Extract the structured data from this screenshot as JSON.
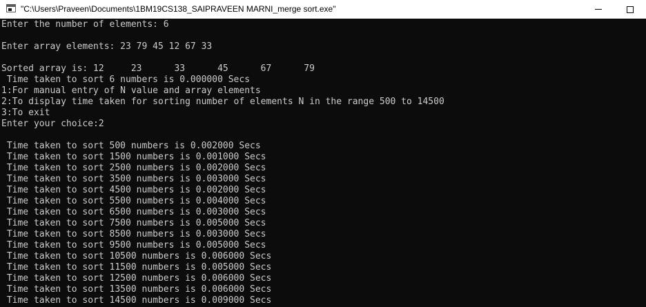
{
  "window": {
    "title": "\"C:\\Users\\Praveen\\Documents\\1BM19CS138_SAIPRAVEEN MARNI_merge sort.exe\"",
    "icon": "console-app-icon"
  },
  "console": {
    "lines": [
      "Enter the number of elements: 6",
      "",
      "Enter array elements: 23 79 45 12 67 33",
      "",
      "Sorted array is: 12     23      33      45      67      79",
      " Time taken to sort 6 numbers is 0.000000 Secs",
      "1:For manual entry of N value and array elements",
      "2:To display time taken for sorting number of elements N in the range 500 to 14500",
      "3:To exit",
      "Enter your choice:2",
      "",
      " Time taken to sort 500 numbers is 0.002000 Secs",
      " Time taken to sort 1500 numbers is 0.001000 Secs",
      " Time taken to sort 2500 numbers is 0.002000 Secs",
      " Time taken to sort 3500 numbers is 0.003000 Secs",
      " Time taken to sort 4500 numbers is 0.002000 Secs",
      " Time taken to sort 5500 numbers is 0.004000 Secs",
      " Time taken to sort 6500 numbers is 0.003000 Secs",
      " Time taken to sort 7500 numbers is 0.005000 Secs",
      " Time taken to sort 8500 numbers is 0.003000 Secs",
      " Time taken to sort 9500 numbers is 0.005000 Secs",
      " Time taken to sort 10500 numbers is 0.006000 Secs",
      " Time taken to sort 11500 numbers is 0.005000 Secs",
      " Time taken to sort 12500 numbers is 0.006000 Secs",
      " Time taken to sort 13500 numbers is 0.006000 Secs",
      " Time taken to sort 14500 numbers is 0.009000 Secs"
    ]
  },
  "colors": {
    "console_bg": "#0c0c0c",
    "console_text": "#cccccc",
    "titlebar_bg": "#ffffff"
  }
}
